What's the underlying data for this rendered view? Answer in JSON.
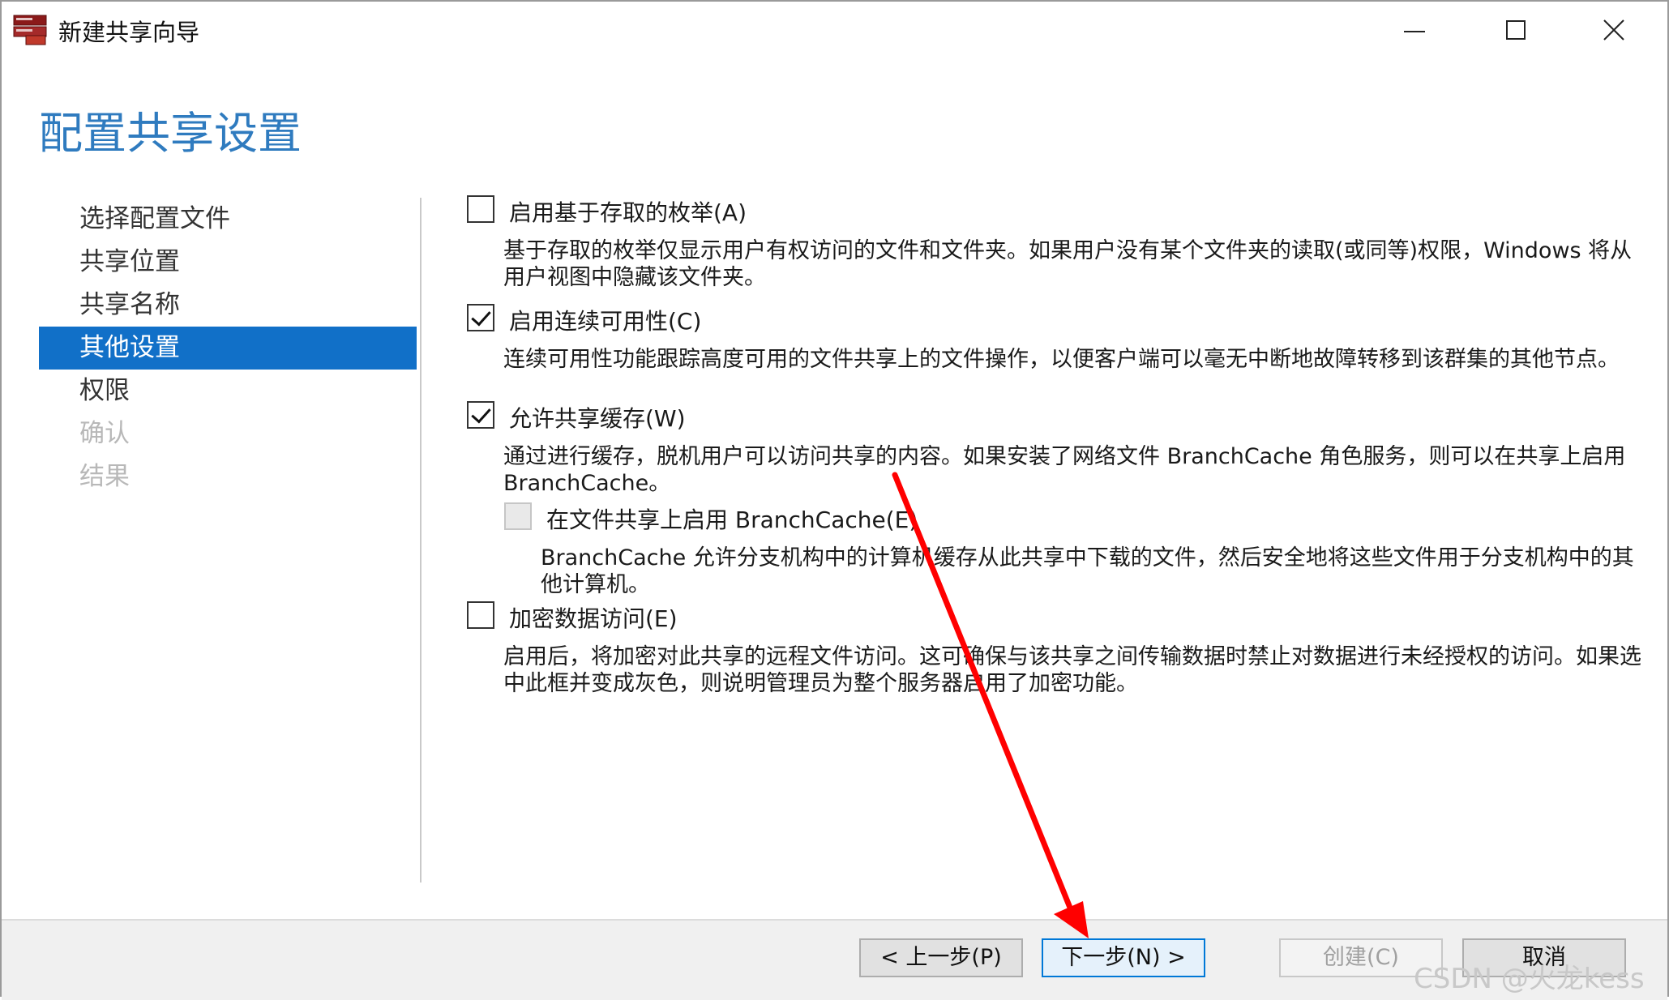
{
  "window": {
    "title": "新建共享向导",
    "icon": "server-share-icon"
  },
  "page": {
    "heading": "配置共享设置"
  },
  "nav": {
    "items": [
      {
        "label": "选择配置文件",
        "state": "normal"
      },
      {
        "label": "共享位置",
        "state": "normal"
      },
      {
        "label": "共享名称",
        "state": "normal"
      },
      {
        "label": "其他设置",
        "state": "active"
      },
      {
        "label": "权限",
        "state": "normal"
      },
      {
        "label": "确认",
        "state": "disabled"
      },
      {
        "label": "结果",
        "state": "disabled"
      }
    ]
  },
  "options": {
    "abe": {
      "label": "启用基于存取的枚举(A)",
      "checked": false,
      "description": "基于存取的枚举仅显示用户有权访问的文件和文件夹。如果用户没有某个文件夹的读取(或同等)权限，Windows 将从用户视图中隐藏该文件夹。"
    },
    "ca": {
      "label": "启用连续可用性(C)",
      "checked": true,
      "description": "连续可用性功能跟踪高度可用的文件共享上的文件操作，以便客户端可以毫无中断地故障转移到该群集的其他节点。"
    },
    "cache": {
      "label": "允许共享缓存(W)",
      "checked": true,
      "description": "通过进行缓存，脱机用户可以访问共享的内容。如果安装了网络文件 BranchCache 角色服务，则可以在共享上启用 BranchCache。"
    },
    "branchcache": {
      "label": "在文件共享上启用 BranchCache(E)",
      "checked": false,
      "enabled": false,
      "description": "BranchCache 允许分支机构中的计算机缓存从此共享中下载的文件，然后安全地将这些文件用于分支机构中的其他计算机。"
    },
    "encrypt": {
      "label": "加密数据访问(E)",
      "checked": false,
      "description": "启用后，将加密对此共享的远程文件访问。这可确保与该共享之间传输数据时禁止对数据进行未经授权的访问。如果选中此框并变成灰色，则说明管理员为整个服务器启用了加密功能。"
    }
  },
  "buttons": {
    "back": "< 上一步(P)",
    "next": "下一步(N) >",
    "create": "创建(C)",
    "cancel": "取消"
  },
  "watermark": "CSDN @火龙kess",
  "colors": {
    "heading": "#2f7bbf",
    "nav_active": "#1170c8",
    "annotation_arrow": "#ff0000"
  }
}
